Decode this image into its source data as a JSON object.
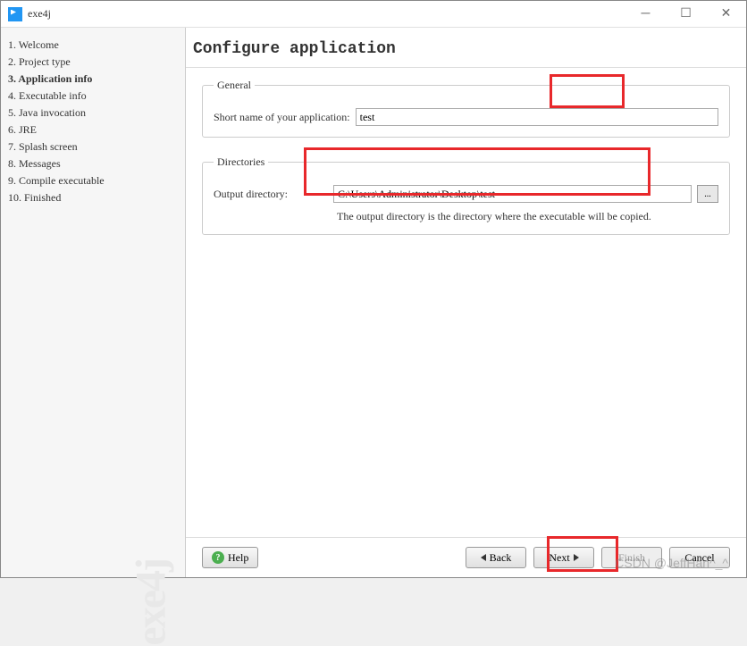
{
  "window": {
    "title": "exe4j"
  },
  "steps": [
    {
      "num": "1.",
      "label": "Welcome"
    },
    {
      "num": "2.",
      "label": "Project type"
    },
    {
      "num": "3.",
      "label": "Application info",
      "active": true
    },
    {
      "num": "4.",
      "label": "Executable info"
    },
    {
      "num": "5.",
      "label": "Java invocation"
    },
    {
      "num": "6.",
      "label": "JRE"
    },
    {
      "num": "7.",
      "label": "Splash screen"
    },
    {
      "num": "8.",
      "label": "Messages"
    },
    {
      "num": "9.",
      "label": "Compile executable"
    },
    {
      "num": "10.",
      "label": "Finished"
    }
  ],
  "sidebar_watermark": "exe4j",
  "page": {
    "title": "Configure application"
  },
  "general": {
    "legend": "General",
    "short_name_label": "Short name of your application:",
    "short_name_value": "test"
  },
  "directories": {
    "legend": "Directories",
    "output_label": "Output directory:",
    "output_value": "C:\\Users\\Administrator\\Desktop\\test",
    "browse_label": "...",
    "help_text": "The output directory is the directory where the executable will be copied."
  },
  "buttons": {
    "help": "Help",
    "back": "Back",
    "next": "Next",
    "finish": "Finish",
    "cancel": "Cancel"
  },
  "watermark": "CSDN @JeffHan^_^"
}
